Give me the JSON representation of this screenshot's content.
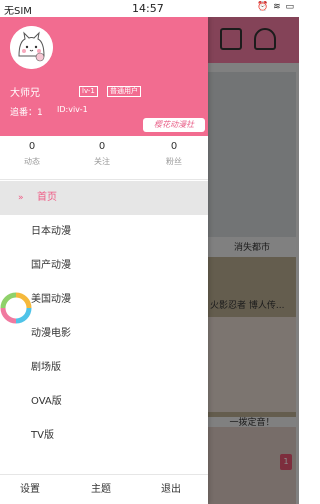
{
  "status": {
    "carrier": "无SIM",
    "time": "14:57",
    "icons": "⏰ ≋ ▭"
  },
  "profile": {
    "username": "大师兄",
    "level": "lv-1",
    "role": "普通用户",
    "follow_count": "追番：1",
    "user_id": "ID:viv-1",
    "logo": "樱花动漫社"
  },
  "stats": [
    {
      "num": "0",
      "label": "动态"
    },
    {
      "num": "0",
      "label": "关注"
    },
    {
      "num": "0",
      "label": "粉丝"
    }
  ],
  "menu": {
    "arrow": "»",
    "items": [
      "首页",
      "日本动漫",
      "国产动漫",
      "美国动漫",
      "动漫电影",
      "剧场版",
      "OVA版",
      "TV版"
    ]
  },
  "bottom": {
    "settings": "设置",
    "theme": "主题",
    "exit": "退出"
  },
  "background": {
    "card_labels": [
      "消失都市",
      "火影忍者 博人传...",
      "一拨定音！"
    ],
    "badge": "1"
  },
  "colors": {
    "accent": "#f26c90",
    "active_text": "#ef5b85"
  }
}
